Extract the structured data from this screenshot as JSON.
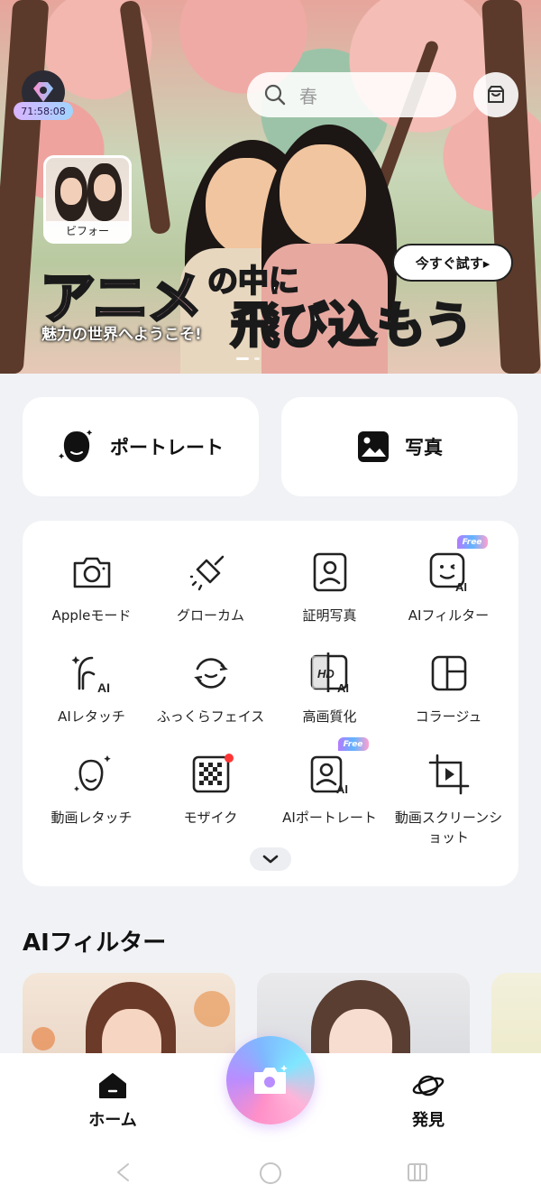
{
  "banner": {
    "timer": "71:58:08",
    "search_placeholder": "春",
    "before_label": "ビフォー",
    "try_button": "今すぐ試す▸",
    "title_line1": "アニメ",
    "title_line2": "の中に",
    "title_line3": "飛び込もう",
    "subtitle": "魅力の世界へようこそ!"
  },
  "cards": {
    "portrait": "ポートレート",
    "photo": "写真"
  },
  "tools": [
    {
      "label": "Appleモード",
      "badge": ""
    },
    {
      "label": "グローカム",
      "badge": ""
    },
    {
      "label": "証明写真",
      "badge": ""
    },
    {
      "label": "AIフィルター",
      "badge": "Free"
    },
    {
      "label": "AIレタッチ",
      "badge": ""
    },
    {
      "label": "ふっくらフェイス",
      "badge": ""
    },
    {
      "label": "高画質化",
      "badge": ""
    },
    {
      "label": "コラージュ",
      "badge": ""
    },
    {
      "label": "動画レタッチ",
      "badge": ""
    },
    {
      "label": "モザイク",
      "badge": "dot"
    },
    {
      "label": "AIポートレート",
      "badge": "Free"
    },
    {
      "label": "動画スクリーンショット",
      "badge": ""
    }
  ],
  "ai_filter_section": {
    "title": "AIフィルター"
  },
  "nav": {
    "home": "ホーム",
    "discover": "発見"
  },
  "colors": {
    "accent_gradient": [
      "#ff8fc8",
      "#b98dff",
      "#7fb8ff"
    ],
    "free_badge": "#b47bff",
    "notification_dot": "#ff3535"
  }
}
